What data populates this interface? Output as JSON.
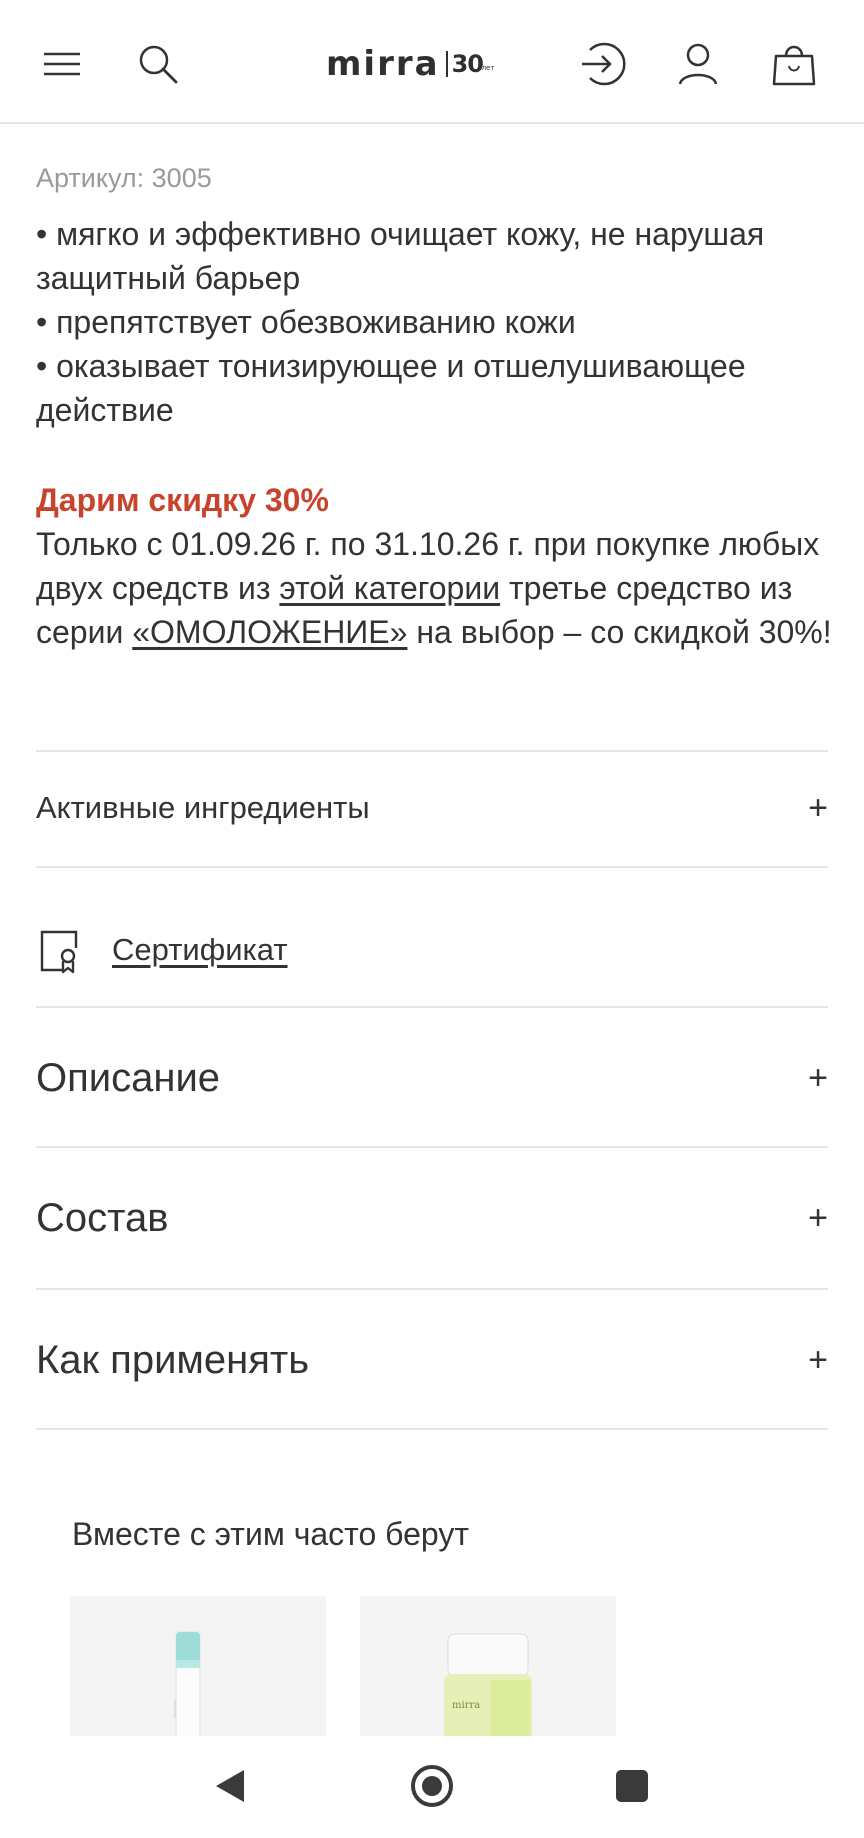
{
  "header": {
    "icons": [
      "menu-icon",
      "search-icon",
      "login-icon",
      "user-icon",
      "cart-icon"
    ],
    "logo": {
      "word": "mirra",
      "badge": "30",
      "badge_small": "лет"
    }
  },
  "product": {
    "sku": "Артикул: 3005",
    "benefits": [
      "• мягко и эффективно очищает кожу, не нарушая защитный барьер",
      "• препятствует обезвоживанию кожи",
      "• оказывает тонизирующее и отшелушивающее действие"
    ]
  },
  "promo": {
    "title": "Дарим скидку 30%",
    "text_1": "Только с 01.09.26 г. по 31.10.26 г. при покупке любых двух средств из ",
    "link_category": "этой категории",
    "text_2": " третье средство из серии ",
    "link_series": "«ОМОЛОЖЕНИЕ»",
    "text_3": " на выбор – со скидкой 30%!",
    "accent_color": "#c8432c"
  },
  "sections": {
    "active_ingredients": "Активные ингредиенты",
    "certificate": "Сертификат",
    "description": "Описание",
    "composition": "Состав",
    "how_to_use": "Как применять",
    "expand_symbol": "+"
  },
  "recommendations": {
    "title": "Вместе с этим часто берут",
    "product_label": "mirra"
  },
  "navbar": {
    "icons": [
      "back-icon",
      "home-icon",
      "recents-icon"
    ]
  }
}
